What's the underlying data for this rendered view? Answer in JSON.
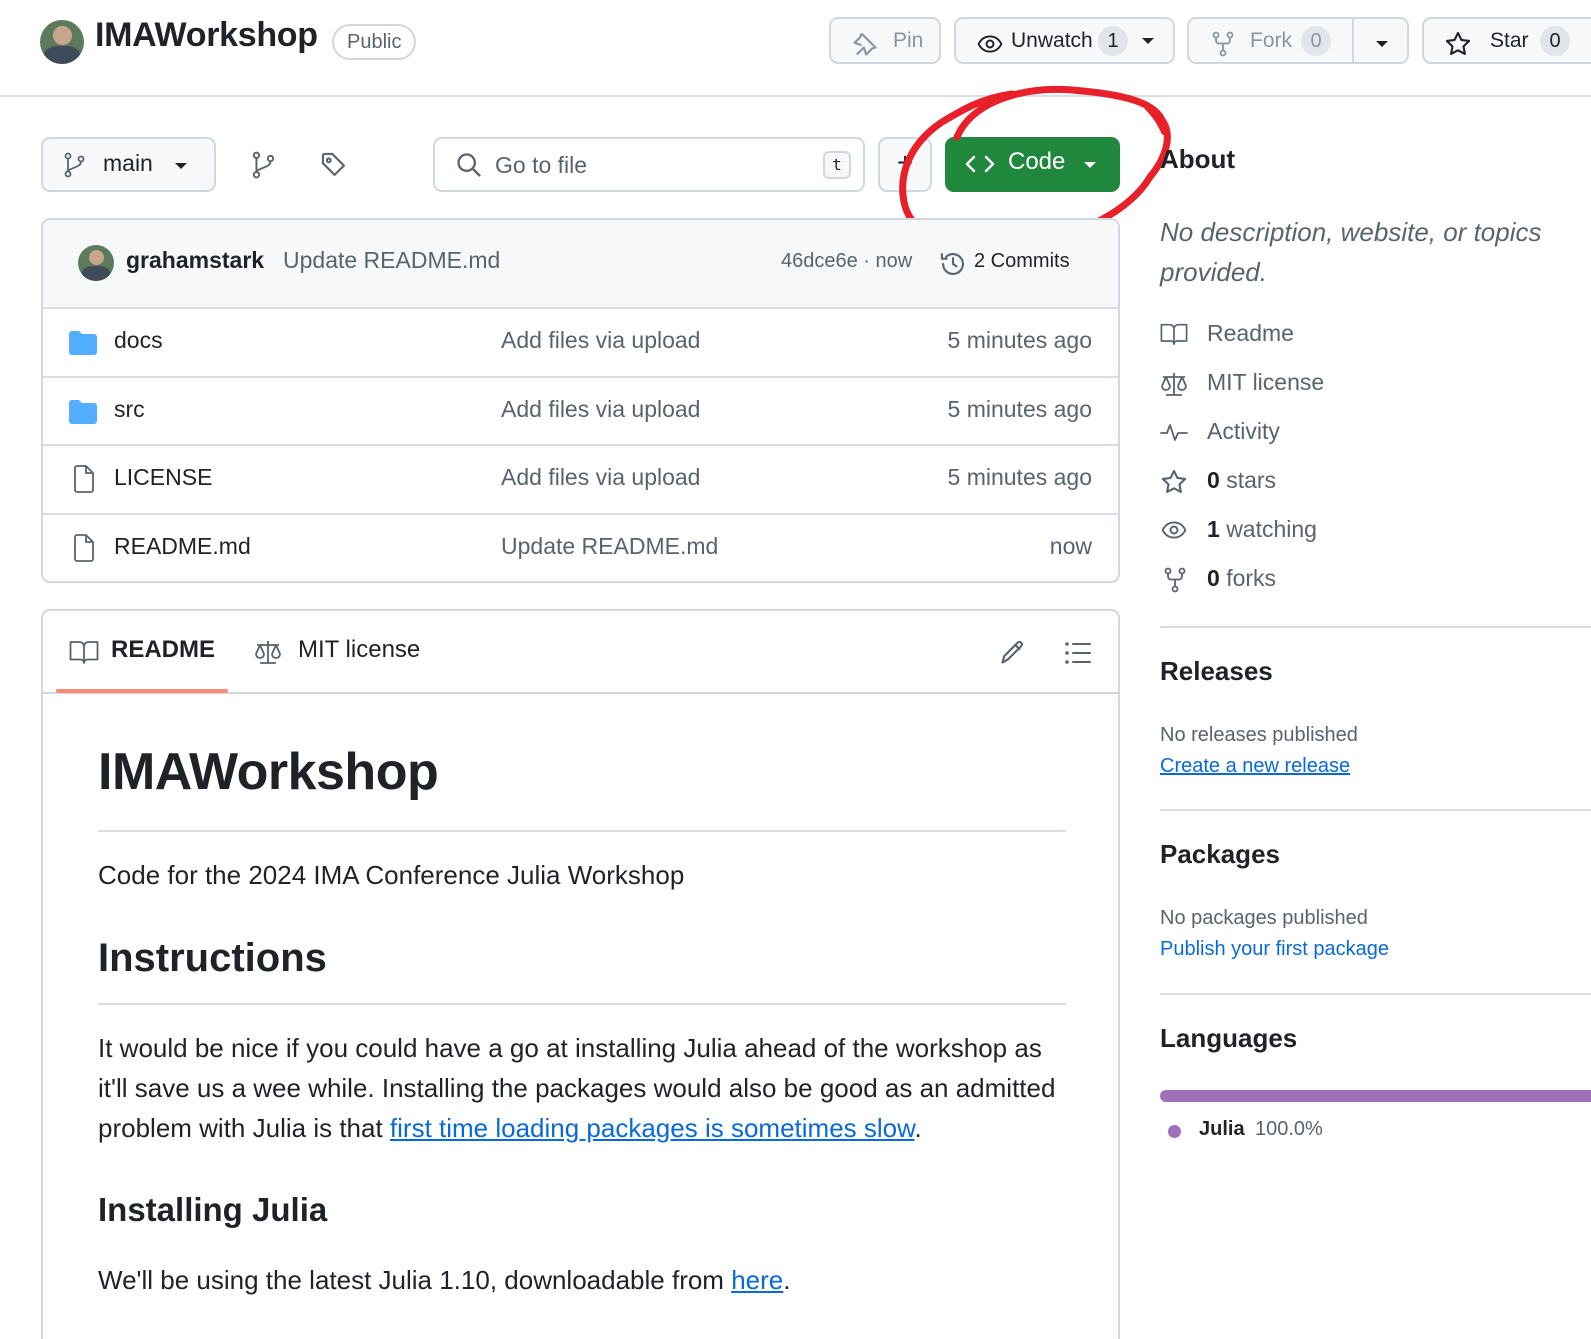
{
  "repo": {
    "name": "IMAWorkshop",
    "visibility": "Public"
  },
  "header_actions": {
    "pin_label": "Pin",
    "unwatch_label": "Unwatch",
    "watch_count": "1",
    "fork_label": "Fork",
    "fork_count": "0",
    "star_label": "Star",
    "star_count": "0"
  },
  "toolbar": {
    "branch": "main",
    "goto_placeholder": "Go to file",
    "goto_shortcut": "t",
    "add_label": "+",
    "code_label": "Code"
  },
  "latest_commit": {
    "author": "grahamstark",
    "message": "Update README.md",
    "sha_time": "46dce6e · now",
    "commits_label": "2 Commits"
  },
  "files": [
    {
      "name": "docs",
      "type": "folder",
      "message": "Add files via upload",
      "age": "5 minutes ago"
    },
    {
      "name": "src",
      "type": "folder",
      "message": "Add files via upload",
      "age": "5 minutes ago"
    },
    {
      "name": "LICENSE",
      "type": "file",
      "message": "Add files via upload",
      "age": "5 minutes ago"
    },
    {
      "name": "README.md",
      "type": "file",
      "message": "Update README.md",
      "age": "now"
    }
  ],
  "readme_tabs": {
    "readme": "README",
    "license": "MIT license"
  },
  "readme": {
    "title": "IMAWorkshop",
    "intro": "Code for the 2024 IMA Conference Julia Workshop",
    "instructions_heading": "Instructions",
    "instructions_text": "It would be nice if you could have a go at installing Julia ahead of the workshop as it'll save us a wee while. Installing the packages would also be good as an admitted problem with Julia is that ",
    "instructions_link": "first time loading packages is sometimes slow",
    "instructions_end": ".",
    "install_heading": "Installing Julia",
    "install_text": "We'll be using the latest Julia 1.10, downloadable from ",
    "install_link": "here",
    "install_end": "."
  },
  "about": {
    "heading": "About",
    "description": "No description, website, or topics provided.",
    "readme": "Readme",
    "license": "MIT license",
    "activity": "Activity",
    "stars_count": "0",
    "stars_label": "stars",
    "watching_count": "1",
    "watching_label": "watching",
    "forks_count": "0",
    "forks_label": "forks"
  },
  "releases": {
    "heading": "Releases",
    "empty": "No releases published",
    "link": "Create a new release"
  },
  "packages": {
    "heading": "Packages",
    "empty": "No packages published",
    "link": "Publish your first package"
  },
  "languages": {
    "heading": "Languages",
    "items": [
      {
        "name": "Julia",
        "percent": "100.0%",
        "color": "#a270ba"
      }
    ]
  },
  "colors": {
    "code_button": "#1f883d",
    "annotation": "#e8202a",
    "link": "#0969da",
    "tab_underline": "#fd8c73"
  }
}
